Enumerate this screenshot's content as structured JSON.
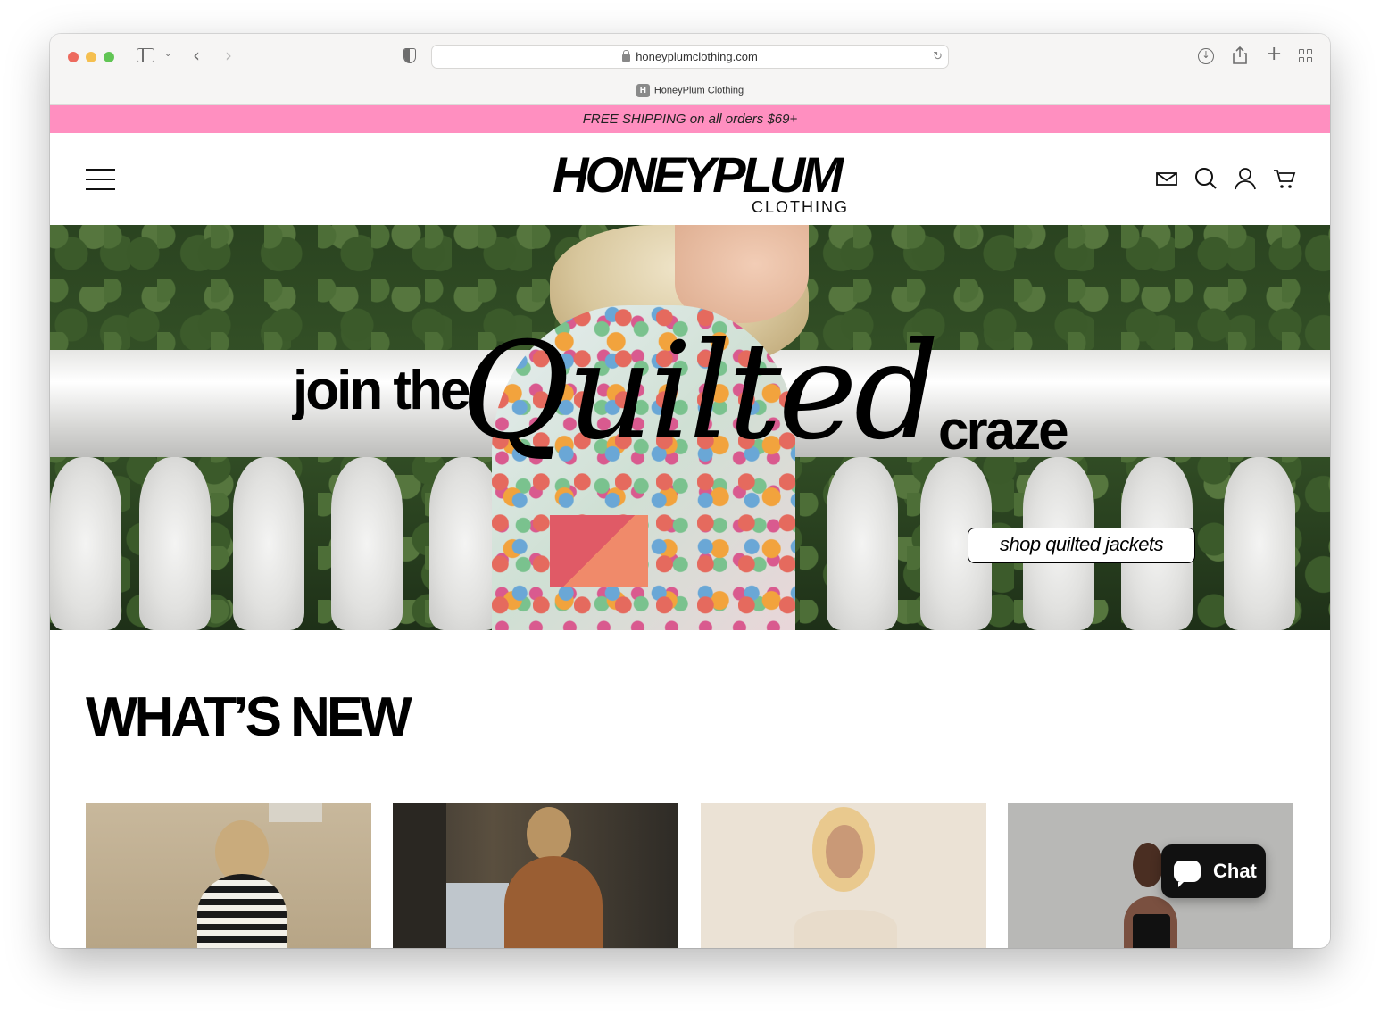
{
  "browser": {
    "url": "honeyplumclothing.com",
    "tab_title": "HoneyPlum Clothing",
    "favicon_letter": "H"
  },
  "promo": {
    "text": "FREE SHIPPING on all orders $69+"
  },
  "header": {
    "logo_main": "HONEYPLUM",
    "logo_sub": "CLOTHING",
    "icons": [
      "mail-icon",
      "search-icon",
      "account-icon",
      "cart-icon"
    ]
  },
  "hero": {
    "text_join": "join the",
    "text_script": "Quilted",
    "text_craze": "craze",
    "cta_label": "shop quilted jackets"
  },
  "whats_new": {
    "title": "WHAT’S NEW"
  },
  "chat": {
    "label": "Chat"
  },
  "colors": {
    "promo_bg": "#ff8fc0",
    "text": "#000000"
  }
}
